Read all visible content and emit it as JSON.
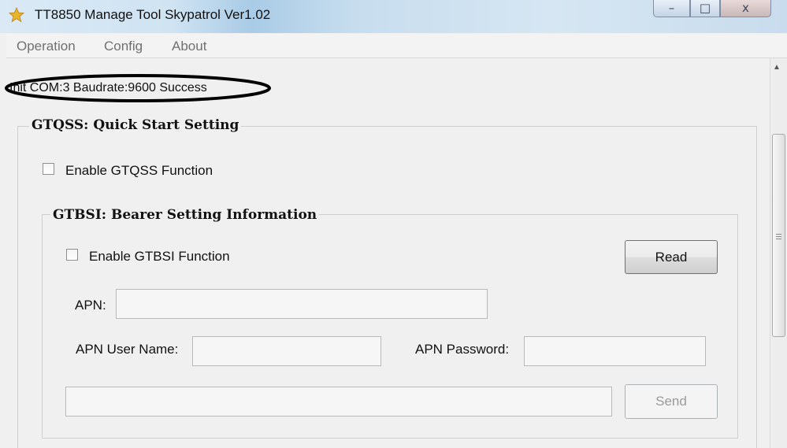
{
  "window": {
    "title": "TT8850 Manage Tool Skypatrol Ver1.02",
    "minimize_glyph": "–",
    "maximize_glyph": "□",
    "close_glyph": "x"
  },
  "menu": {
    "items": [
      "Operation",
      "Config",
      "About"
    ]
  },
  "status": {
    "text": "Init COM:3 Baudrate:9600 Success"
  },
  "gtqss": {
    "group_title": "GTQSS: Quick Start Setting",
    "enable_label": "Enable GTQSS Function",
    "enabled": false
  },
  "gtbsi": {
    "group_title": "GTBSI: Bearer Setting Information",
    "enable_label": "Enable GTBSI Function",
    "enabled": false,
    "read_button": "Read",
    "apn_label": "APN:",
    "apn_value": "",
    "user_label": "APN User Name:",
    "user_value": "",
    "password_label": "APN Password:",
    "password_value": "",
    "command_value": "",
    "send_button": "Send"
  },
  "colors": {
    "annotation_ellipse": "#000000",
    "disabled_text": "#9a9a9a"
  },
  "icons": {
    "app": "star-icon",
    "scroll_up": "arrow-up-icon"
  }
}
